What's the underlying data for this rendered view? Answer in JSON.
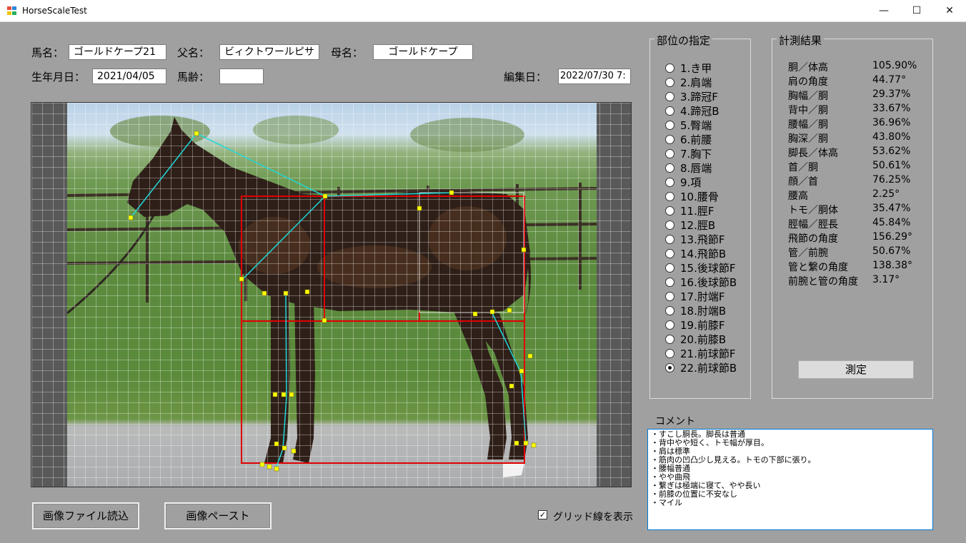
{
  "window": {
    "title": "HorseScaleTest",
    "minimize_glyph": "—",
    "maximize_glyph": "☐",
    "close_glyph": "✕"
  },
  "info": {
    "horse_name_label": "馬名：",
    "horse_name_value": "ゴールドケープ21",
    "sire_label": "父名：",
    "sire_value": "ビィクトワールピサ",
    "dam_label": "母名：",
    "dam_value": "ゴールドケープ",
    "birthdate_label": "生年月日：",
    "birthdate_value": "2021/04/05",
    "age_label": "馬齢：",
    "age_value": "",
    "edit_date_label": "編集日：",
    "edit_date_value": "2022/07/30 7:"
  },
  "parts": {
    "title": "部位の指定",
    "selected_index": 21,
    "items": [
      {
        "label": "1.き甲"
      },
      {
        "label": "2.肩端"
      },
      {
        "label": "3.蹄冠F"
      },
      {
        "label": "4.蹄冠B"
      },
      {
        "label": "5.臀端"
      },
      {
        "label": "6.前腰"
      },
      {
        "label": "7.胸下"
      },
      {
        "label": "8.唇端"
      },
      {
        "label": "9.項"
      },
      {
        "label": "10.腰骨"
      },
      {
        "label": "11.脛F"
      },
      {
        "label": "12.脛B"
      },
      {
        "label": "13.飛節F"
      },
      {
        "label": "14.飛節B"
      },
      {
        "label": "15.後球節F"
      },
      {
        "label": "16.後球節B"
      },
      {
        "label": "17.肘端F"
      },
      {
        "label": "18.肘端B"
      },
      {
        "label": "19.前膝F"
      },
      {
        "label": "20.前膝B"
      },
      {
        "label": "21.前球節F"
      },
      {
        "label": "22.前球節B"
      }
    ]
  },
  "results": {
    "title": "計測結果",
    "rows": [
      {
        "name": "胴／体高",
        "value": "105.90%"
      },
      {
        "name": "肩の角度",
        "value": "44.77°"
      },
      {
        "name": "胸幅／胴",
        "value": "29.37%"
      },
      {
        "name": "背中／胴",
        "value": "33.67%"
      },
      {
        "name": "腰幅／胴",
        "value": "36.96%"
      },
      {
        "name": "胸深／胴",
        "value": "43.80%"
      },
      {
        "name": "脚長／体高",
        "value": "53.62%"
      },
      {
        "name": "首／胴",
        "value": "50.61%"
      },
      {
        "name": "顔／首",
        "value": "76.25%"
      },
      {
        "name": "腰高",
        "value": "2.25°"
      },
      {
        "name": "トモ／胴体",
        "value": "35.47%"
      },
      {
        "name": "脛幅／脛長",
        "value": "45.84%"
      },
      {
        "name": "飛節の角度",
        "value": "156.29°"
      },
      {
        "name": "管／前腕",
        "value": "50.67%"
      },
      {
        "name": "管と繋の角度",
        "value": "138.38°"
      },
      {
        "name": "前腕と管の角度",
        "value": "3.17°"
      }
    ],
    "measure_button": "測定"
  },
  "comment": {
    "label": "コメント",
    "lines": [
      "・すこし胴長。脚長は普通",
      "・背中やや短く、トモ幅が厚目。",
      "・肩は標準",
      "・筋肉の凹凸少し見える。トモの下部に張り。",
      "・腰幅普通",
      "・やや曲飛",
      "・繋ぎは極端に寝て、やや長い",
      "・前膝の位置に不安なし",
      "・マイル"
    ]
  },
  "buttons": {
    "load_image": "画像ファイル読込",
    "paste_image": "画像ペースト"
  },
  "grid_option": {
    "label": "グリッド線を表示",
    "checked": true,
    "check_glyph": "✓"
  },
  "colors": {
    "marker": "#ffff00",
    "skeleton_line": "#20d8d8",
    "frame_line": "#e00000"
  }
}
